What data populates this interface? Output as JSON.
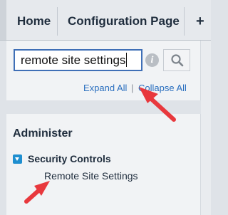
{
  "tabs": {
    "home": "Home",
    "configuration": "Configuration Page",
    "add": "+"
  },
  "search": {
    "value": "remote site settings"
  },
  "links": {
    "expand_all": "Expand All",
    "separator": "|",
    "collapse_all": "Collapse All"
  },
  "sidebar": {
    "heading": "Administer",
    "section": {
      "label": "Security Controls",
      "items": [
        "Remote Site Settings"
      ]
    }
  },
  "colors": {
    "accent_blue": "#3f6fb6",
    "link_blue": "#2a6fbf",
    "tree_toggle": "#1f8fd0",
    "annotation_arrow": "#e8383d"
  },
  "icons": {
    "info": "info-icon",
    "search": "search-icon",
    "expand": "triangle-down-icon",
    "annotation": "arrow-annotation-icon"
  }
}
